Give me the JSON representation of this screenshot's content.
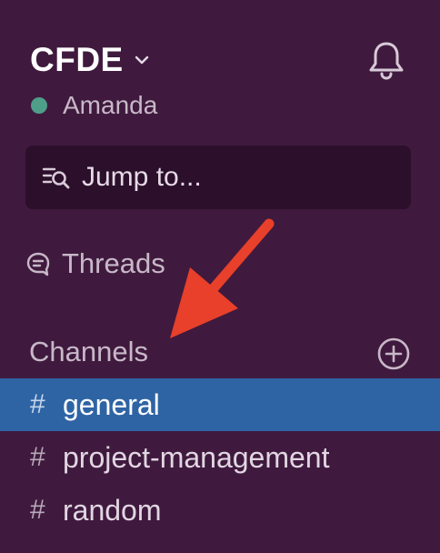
{
  "workspace": {
    "name": "CFDE",
    "user": "Amanda",
    "presence_color": "#4f9e8a"
  },
  "search": {
    "label": "Jump to..."
  },
  "nav": {
    "threads_label": "Threads"
  },
  "channels": {
    "header": "Channels",
    "items": [
      {
        "hash": "#",
        "name": "general",
        "active": true
      },
      {
        "hash": "#",
        "name": "project-management",
        "active": false
      },
      {
        "hash": "#",
        "name": "random",
        "active": false
      }
    ]
  },
  "colors": {
    "sidebar_bg": "#3f1a3e",
    "active_bg": "#2e64a4",
    "annotation_arrow": "#e8402a"
  },
  "icons": [
    "chevron-down-icon",
    "bell-icon",
    "search-icon",
    "threads-icon",
    "plus-circle-icon",
    "annotation-arrow"
  ]
}
